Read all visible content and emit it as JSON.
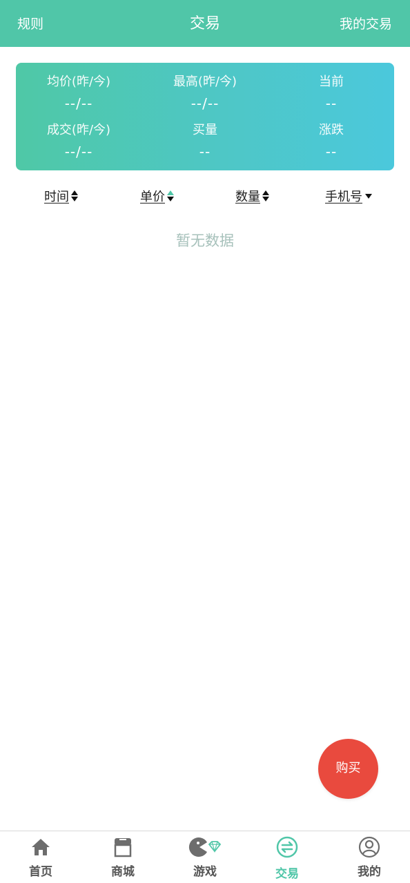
{
  "header": {
    "left": "规则",
    "title": "交易",
    "right": "我的交易"
  },
  "stats": [
    {
      "label": "均价(昨/今)",
      "value": "--/--"
    },
    {
      "label": "最高(昨/今)",
      "value": "--/--"
    },
    {
      "label": "当前",
      "value": "--"
    },
    {
      "label": "成交(昨/今)",
      "value": "--/--"
    },
    {
      "label": "买量",
      "value": "--"
    },
    {
      "label": "涨跌",
      "value": "--"
    }
  ],
  "sort": [
    {
      "label": "时间",
      "indicator": "up-down"
    },
    {
      "label": "单价",
      "indicator": "up-active"
    },
    {
      "label": "数量",
      "indicator": "up-down"
    },
    {
      "label": "手机号",
      "indicator": "down"
    }
  ],
  "empty_text": "暂无数据",
  "buy_label": "购买",
  "tabs": [
    {
      "label": "首页",
      "icon": "home-icon"
    },
    {
      "label": "商城",
      "icon": "shop-icon"
    },
    {
      "label": "游戏",
      "icon": "game-icon"
    },
    {
      "label": "交易",
      "icon": "exchange-icon",
      "active": true
    },
    {
      "label": "我的",
      "icon": "user-icon"
    }
  ],
  "colors": {
    "primary": "#50c6a8",
    "buy": "#e94a3e",
    "empty": "#a7c1bb"
  }
}
